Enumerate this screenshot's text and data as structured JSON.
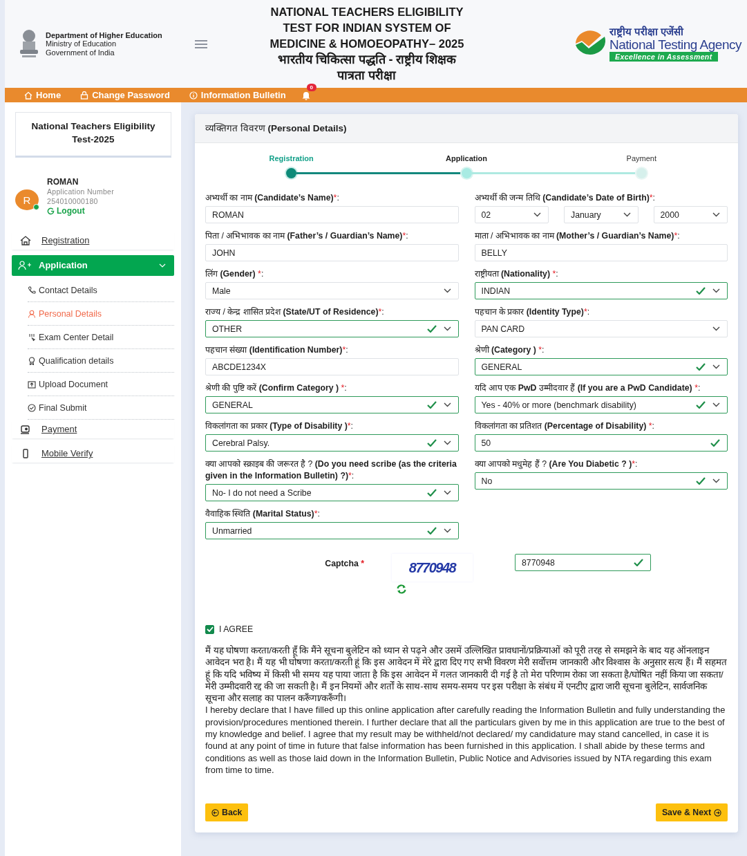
{
  "header": {
    "department": "Department of Higher Education",
    "ministry": "Ministry of Education",
    "government": "Government of India",
    "title_en": "NATIONAL TEACHERS ELIGIBILITY TEST FOR INDIAN SYSTEM OF MEDICINE & HOMOEOPATHY– 2025",
    "title_hi": "भारतीय चिकित्सा पद्धति - राष्ट्रीय शिक्षक पात्रता परीक्षा",
    "agency_hi": "राष्ट्रीय परीक्षा एजेंसी",
    "agency_en": "National Testing Agency",
    "agency_tagline": "Excellence in Assessment"
  },
  "nav": [
    {
      "label": "Home"
    },
    {
      "label": "Change Password"
    },
    {
      "label": "Information Bulletin"
    }
  ],
  "notifications": {
    "count": "0"
  },
  "sidebar": {
    "exam_title": "National Teachers Eligibility Test-2025",
    "user": {
      "initial": "R",
      "online": true,
      "name": "ROMAN",
      "number_label": "Application Number",
      "number": "254010000180",
      "logout": "Logout"
    },
    "items": [
      {
        "label": "Registration",
        "selected": false
      },
      {
        "label": "Application",
        "selected": true,
        "expanded": true,
        "children": [
          {
            "label": "Contact Details",
            "selected": false
          },
          {
            "label": "Personal Details",
            "selected": true
          },
          {
            "label": "Exam Center Detail",
            "selected": false
          },
          {
            "label": "Qualification details",
            "selected": false
          },
          {
            "label": "Upload Document",
            "selected": false
          },
          {
            "label": "Final Submit",
            "selected": false
          }
        ]
      },
      {
        "label": "Payment",
        "selected": false
      },
      {
        "label": "Mobile Verify",
        "selected": false
      }
    ]
  },
  "card": {
    "title": "व्यक्तिगत विवरण **(Personal Details)**",
    "steps": [
      {
        "label": "Registration",
        "completed": true,
        "selected": false
      },
      {
        "label": "Application",
        "completed": false,
        "selected": true
      },
      {
        "label": "Payment",
        "completed": false,
        "selected": false
      }
    ],
    "fields": [
      {
        "kind": "text",
        "label": "अभ्यर्थी का नाम **(Candidate’s Name)**",
        "asterisk": "*",
        "end": ":",
        "value": "ROMAN",
        "valid": false
      },
      {
        "kind": "date",
        "label": "अभ्यर्थी की जन्म तिथि **(Candidate’s Date of Birth)**",
        "asterisk": "*",
        "end": ":",
        "values": [
          "02",
          "January",
          "2000"
        ],
        "valid": false
      },
      {
        "kind": "text",
        "label": "पिता / अभिभावक का नाम **(Father’s / Guardian’s Name)**",
        "asterisk": "*",
        "end": ":",
        "value": "JOHN",
        "valid": false
      },
      {
        "kind": "text",
        "label": "माता / अभिभावक का नाम **(Mother’s / Guardian’s Name)**",
        "asterisk": "*",
        "end": ":",
        "value": "BELLY",
        "valid": false
      },
      {
        "kind": "select",
        "label": "लिंग **(Gender)** ",
        "asterisk": "*",
        "end": ":",
        "value": "Male",
        "valid": false
      },
      {
        "kind": "select",
        "label": "राष्ट्रीयता **(Nationality)** ",
        "asterisk": "*",
        "end": ":",
        "value": "INDIAN",
        "valid": true
      },
      {
        "kind": "select",
        "label": "राज्य / केन्द्र शासित प्रदेश **(State/UT of Residence)**",
        "asterisk": "*",
        "end": ":",
        "value": "OTHER",
        "valid": true
      },
      {
        "kind": "select",
        "label": "पहचान के प्रकार **(Identity Type)**",
        "asterisk": "*",
        "end": ":",
        "value": "PAN CARD",
        "valid": false
      },
      {
        "kind": "text",
        "label": "पहचान संख्या **(Identification Number)**",
        "asterisk": "*",
        "end": ":",
        "value": "ABCDE1234X",
        "valid": false
      },
      {
        "kind": "select",
        "label": "श्रेणी **(Category )** ",
        "asterisk": "*",
        "end": ":",
        "value": "GENERAL",
        "valid": true
      },
      {
        "kind": "select",
        "label": "श्रेणी की पुष्टि करें **(Confirm Category )** ",
        "asterisk": "*",
        "end": ":",
        "value": "GENERAL",
        "valid": true
      },
      {
        "kind": "select",
        "label": "यदि आप एक **PwD** उम्मीदवार हैं **(If you are a PwD Candidate)** ",
        "asterisk": "*",
        "end": ":",
        "value": "Yes - 40% or more (benchmark disability)",
        "valid": true
      },
      {
        "kind": "select",
        "label": "विकलांगता का प्रकार **(Type of Disability )**",
        "asterisk": "*",
        "end": ":",
        "value": "Cerebral Palsy.",
        "valid": true
      },
      {
        "kind": "text",
        "label": "विकलांगता का प्रतिशत **(Percentage of Disability)** ",
        "asterisk": "*",
        "end": ":",
        "value": "50",
        "valid": true
      },
      {
        "kind": "select",
        "label": "क्या आपको स्क्राइब की जरूरत है ? **(Do you need scribe (as the criteria given in the Information Bulletin) ?)**",
        "asterisk": "*",
        "end": ":",
        "value": "No- I do not need a Scribe",
        "valid": true
      },
      {
        "kind": "select",
        "label": "क्या आपको मधुमेह हैं ? **(Are You Diabetic ? )**",
        "asterisk": "*",
        "end": ":",
        "value": "No",
        "valid": true
      },
      {
        "kind": "select",
        "label": "वैवाहिक स्थिति **(Marital Status)**",
        "asterisk": "*",
        "end": ":",
        "value": "Unmarried",
        "valid": true
      }
    ],
    "captcha": {
      "label": "Captcha",
      "asterisk": "*",
      "image_text": "8770948",
      "value": "8770948",
      "valid": true
    },
    "agree": {
      "label": "I AGREE",
      "checked": true
    },
    "declaration": [
      "मैं यह घोषणा करता/करती हूँ कि मैंने सूचना बुलेटिन को ध्यान से पढ़ने और उसमें उल्लिखित प्रावधानों/प्रक्रियाओं को पूरी तरह से समझने के बाद यह ऑनलाइन आवेदन भरा है। मैं यह भी घोषणा करता/करती हूं कि इस आवेदन में मेरे द्वारा दिए गए सभी विवरण मेरी सर्वोत्तम जानकारी और विश्वास के अनुसार सत्य हैं। मैं सहमत हूं कि यदि भविष्य में किसी भी समय यह पाया जाता है कि इस आवेदन में गलत जानकारी दी गई है तो मेरा परिणाम रोका जा सकता है/घोषित नहीं किया जा सकता/मेरी उम्मीदवारी रद्द की जा सकती है। मैं इन नियमों और शर्तों के साथ-साथ समय-समय पर इस परीक्षा के संबंध में एनटीए द्वारा जारी सूचना बुलेटिन, सार्वजनिक सूचना और सलाह का पालन करूँगा/करूँगी।",
      "I hereby declare that I have filled up this online application after carefully reading the Information Bulletin and fully understanding the provision/procedures mentioned therein. I further declare that all the particulars given by me in this application are true to the best of my knowledge and belief. I agree that my result may be withheld/not declared/ my candidature may stand cancelled, in case it is found at any point of time in future that false information has been furnished in this application. I shall abide by these terms and conditions as well as those laid down in the Information Bulletin, Public Notice and Advisories issued by NTA regarding this exam from time to time."
    ],
    "back": "Back",
    "next": "Save & Next"
  }
}
